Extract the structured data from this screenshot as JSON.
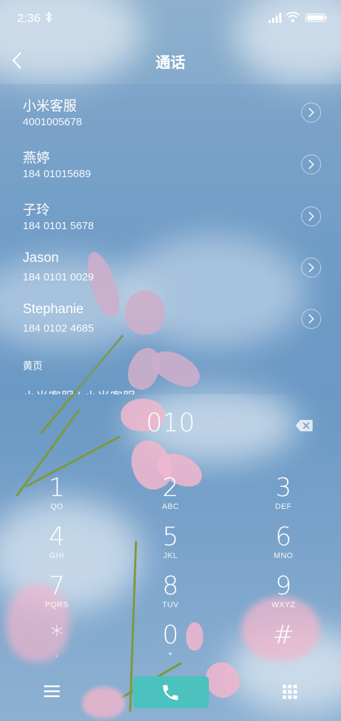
{
  "status_bar": {
    "time": "2:36"
  },
  "header": {
    "title": "通话"
  },
  "contacts": [
    {
      "name": "小米客服",
      "number": "4001005678"
    },
    {
      "name": "燕婷",
      "number": "184 01015689"
    },
    {
      "name": "子玲",
      "number": "184 0101 5678"
    },
    {
      "name": "Jason",
      "number": "184 0101 0029"
    },
    {
      "name": "Stephanie",
      "number": "184 0102 4685"
    }
  ],
  "section": {
    "yellow_pages": "黄页",
    "partial_row": "小米客服 | 小米客服"
  },
  "dialer": {
    "input": "010",
    "keys": [
      {
        "digit": "1",
        "letters": "QO"
      },
      {
        "digit": "2",
        "letters": "ABC"
      },
      {
        "digit": "3",
        "letters": "DEF"
      },
      {
        "digit": "4",
        "letters": "GHI"
      },
      {
        "digit": "5",
        "letters": "JKL"
      },
      {
        "digit": "6",
        "letters": "MNO"
      },
      {
        "digit": "7",
        "letters": "PQRS"
      },
      {
        "digit": "8",
        "letters": "TUV"
      },
      {
        "digit": "9",
        "letters": "WXYZ"
      },
      {
        "digit": "*",
        "letters": ","
      },
      {
        "digit": "0",
        "letters": "+"
      },
      {
        "digit": "#",
        "letters": ""
      }
    ]
  },
  "icons": {
    "back": "back-icon",
    "delete": "backspace-icon",
    "menu": "menu-icon",
    "call": "phone-icon",
    "keypad": "keypad-icon",
    "detail": "chevron-right-icon"
  },
  "colors": {
    "call_button": "#4bc2bd",
    "petal": "#f1b6cc",
    "sky": "#6f9dc6"
  }
}
